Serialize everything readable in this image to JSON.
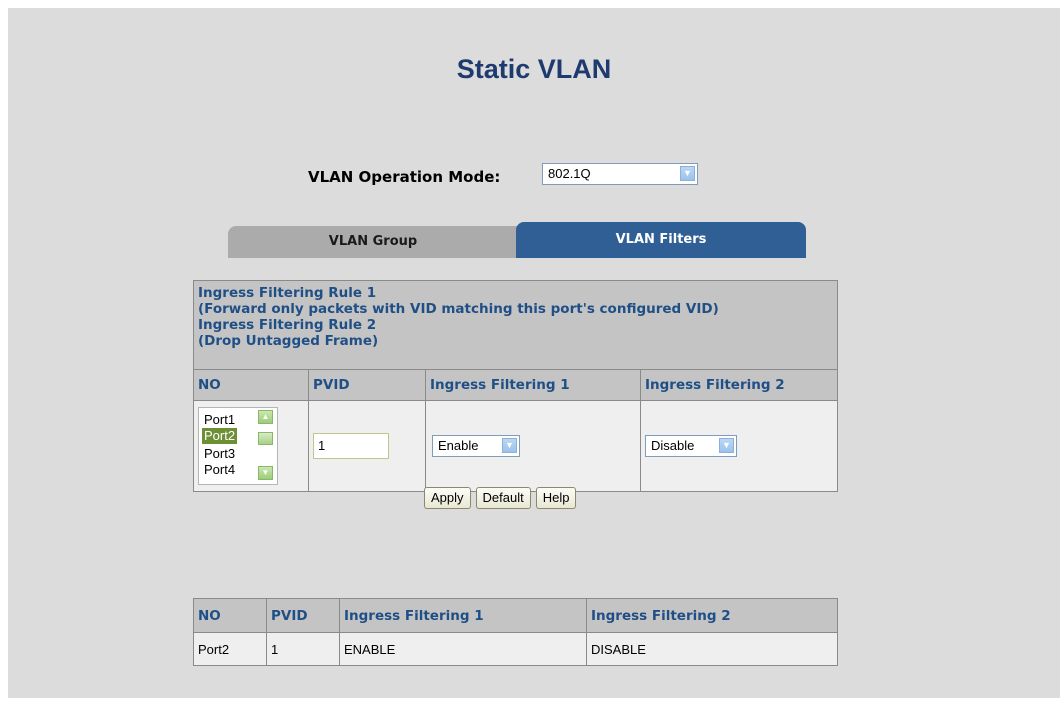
{
  "title": "Static VLAN",
  "operation_mode": {
    "label": "VLAN Operation Mode:",
    "value": "802.1Q"
  },
  "tabs": {
    "group": "VLAN Group",
    "filters": "VLAN Filters"
  },
  "rules": {
    "line1": "Ingress Filtering Rule 1",
    "line2": "(Forward only packets with VID matching this port's configured VID)",
    "line3": "Ingress Filtering Rule 2",
    "line4": "(Drop Untagged Frame)"
  },
  "columns": {
    "no": "NO",
    "pvid": "PVID",
    "ingress1": "Ingress Filtering 1",
    "ingress2": "Ingress Filtering 2"
  },
  "form": {
    "ports": [
      "Port1",
      "Port2",
      "Port3",
      "Port4"
    ],
    "selected_port": "Port2",
    "pvid_value": "1",
    "ingress1_value": "Enable",
    "ingress2_value": "Disable"
  },
  "buttons": {
    "apply": "Apply",
    "default": "Default",
    "help": "Help"
  },
  "status": {
    "headers": [
      "NO",
      "PVID",
      "Ingress Filtering 1",
      "Ingress Filtering 2"
    ],
    "rows": [
      [
        "Port2",
        "1",
        "ENABLE",
        "DISABLE"
      ]
    ]
  },
  "colors": {
    "title": "#1e3a6e",
    "header_text": "#1f4f86",
    "active_tab": "#2f5f94",
    "selected_item": "#6d8f36"
  }
}
